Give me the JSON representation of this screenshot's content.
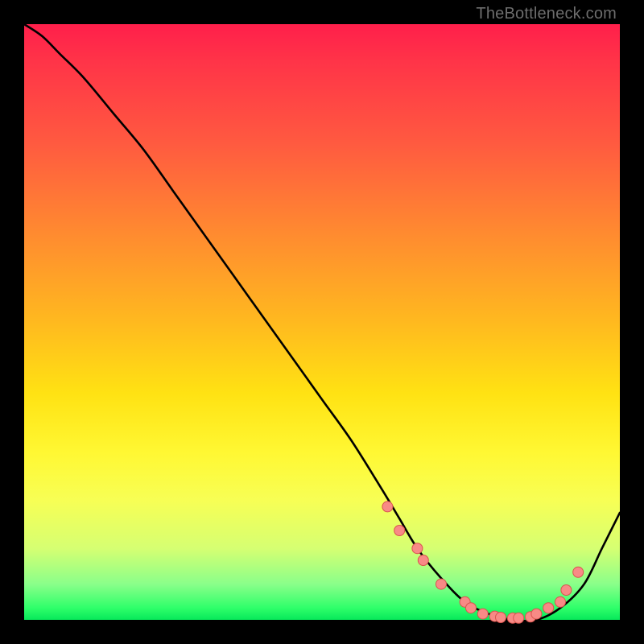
{
  "watermark": "TheBottleneck.com",
  "colors": {
    "bg": "#000000",
    "curve": "#000000",
    "marker_fill": "#f88a86",
    "marker_stroke": "#d9544e"
  },
  "chart_data": {
    "type": "line",
    "title": "",
    "xlabel": "",
    "ylabel": "",
    "xlim": [
      0,
      100
    ],
    "ylim": [
      0,
      100
    ],
    "grid": false,
    "legend": false,
    "series": [
      {
        "name": "bottleneck-curve",
        "x": [
          0,
          3,
          6,
          10,
          15,
          20,
          25,
          30,
          35,
          40,
          45,
          50,
          55,
          60,
          63,
          66,
          70,
          74,
          78,
          82,
          86,
          90,
          94,
          97,
          100
        ],
        "y": [
          100,
          98,
          95,
          91,
          85,
          79,
          72,
          65,
          58,
          51,
          44,
          37,
          30,
          22,
          17,
          12,
          7,
          3,
          1,
          0,
          0,
          2,
          6,
          12,
          18
        ]
      }
    ],
    "markers": {
      "name": "highlight-dots",
      "x": [
        61,
        63,
        66,
        67,
        70,
        74,
        75,
        77,
        79,
        80,
        82,
        83,
        85,
        86,
        88,
        90,
        91,
        93
      ],
      "y": [
        19,
        15,
        12,
        10,
        6,
        3,
        2,
        1,
        0.6,
        0.4,
        0.3,
        0.3,
        0.5,
        1,
        2,
        3,
        5,
        8
      ]
    }
  }
}
